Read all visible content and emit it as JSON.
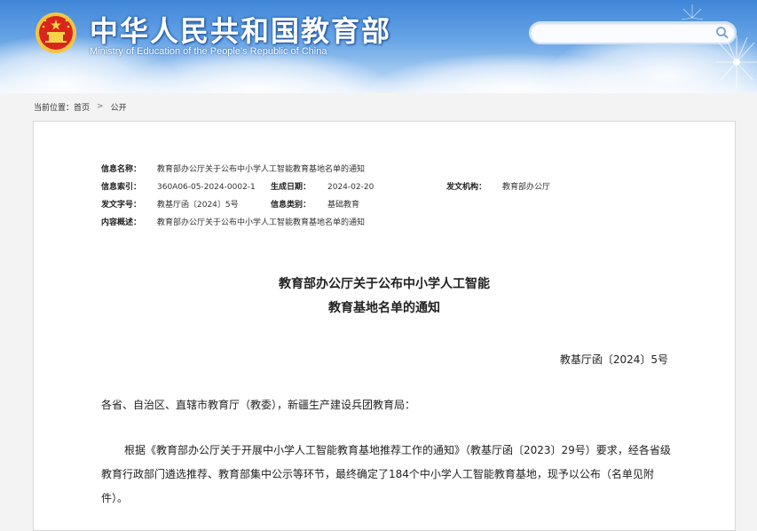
{
  "header": {
    "site_title": "中华人民共和国教育部",
    "site_subtitle": "Ministry of Education of the People's Republic of China",
    "search_placeholder": ""
  },
  "breadcrumb": {
    "prefix": "当前位置：",
    "items": [
      "首页",
      "公开"
    ],
    "separator": ">"
  },
  "meta": {
    "name_label": "信息名称：",
    "name_value": "教育部办公厅关于公布中小学人工智能教育基地名单的通知",
    "index_label": "信息索引：",
    "index_value": "360A06-05-2024-0002-1",
    "date_label": "生成日期：",
    "date_value": "2024-02-20",
    "org_label": "发文机构：",
    "org_value": "教育部办公厅",
    "doc_no_label": "发文字号：",
    "doc_no_value": "教基厅函〔2024〕5号",
    "category_label": "信息类别：",
    "category_value": "基础教育",
    "summary_label": "内容概述：",
    "summary_value": "教育部办公厅关于公布中小学人工智能教育基地名单的通知"
  },
  "article": {
    "title_line1": "教育部办公厅关于公布中小学人工智能",
    "title_line2": "教育基地名单的通知",
    "doc_number": "教基厅函〔2024〕5号",
    "salutation": "各省、自治区、直辖市教育厅（教委），新疆生产建设兵团教育局：",
    "body": "根据《教育部办公厅关于开展中小学人工智能教育基地推荐工作的通知》（教基厅函〔2023〕29号）要求，经各省级教育行政部门遴选推荐、教育部集中公示等环节，最终确定了184个中小学人工智能教育基地，现予以公布（名单见附件）。"
  },
  "colors": {
    "banner_top": "#3f86d8",
    "banner_bottom": "#e6f0fb",
    "page_bg": "#f3f3f3"
  },
  "icons": [
    "national-emblem-icon",
    "search-icon",
    "dandelion-decoration"
  ]
}
